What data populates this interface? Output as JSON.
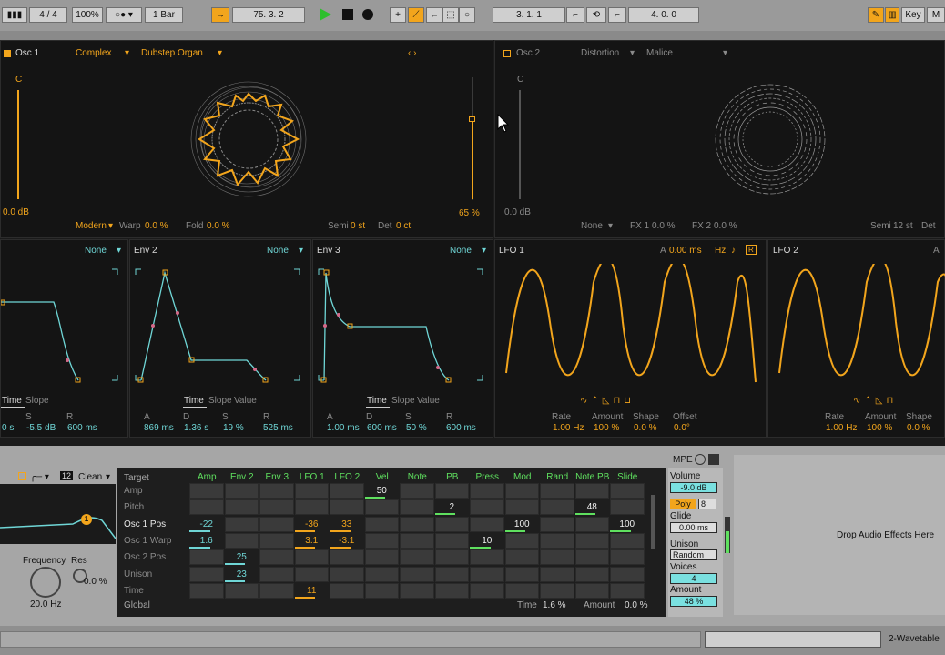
{
  "transport": {
    "signature": "4 / 4",
    "zoom": "100%",
    "quant": "1 Bar",
    "position": "75. 3. 2",
    "loop_start": "3. 1. 1",
    "loop_length": "4. 0. 0",
    "key_label": "Key",
    "m_label": "M"
  },
  "osc1": {
    "title": "Osc 1",
    "category": "Complex",
    "wavetable": "Dubstep Organ",
    "pitch_label": "C",
    "gain": "0.0 dB",
    "mode": "Modern",
    "warp_label": "Warp",
    "warp": "0.0 %",
    "fold_label": "Fold",
    "fold": "0.0 %",
    "semi_label": "Semi",
    "semi": "0 st",
    "det_label": "Det",
    "det": "0 ct",
    "level": "65 %"
  },
  "osc2": {
    "title": "Osc 2",
    "category": "Distortion",
    "wavetable": "Malice",
    "pitch_label": "C",
    "gain": "0.0 dB",
    "mode": "None",
    "fx1_label": "FX 1",
    "fx1": "0.0 %",
    "fx2_label": "FX 2",
    "fx2": "0.0 %",
    "semi_label": "Semi",
    "semi": "12 st",
    "det_label": "Det"
  },
  "env1": {
    "target": "None",
    "tabs": [
      "Time",
      "Slope"
    ],
    "labels": [
      "S",
      "R"
    ],
    "values": [
      "0 s",
      "-5.5 dB",
      "600 ms"
    ]
  },
  "env2": {
    "title": "Env 2",
    "target": "None",
    "tabs": [
      "Time",
      "Slope",
      "Value"
    ],
    "labels": [
      "A",
      "D",
      "S",
      "R"
    ],
    "values": [
      "869 ms",
      "1.36 s",
      "19 %",
      "525 ms"
    ]
  },
  "env3": {
    "title": "Env 3",
    "target": "None",
    "tabs": [
      "Time",
      "Slope",
      "Value"
    ],
    "labels": [
      "A",
      "D",
      "S",
      "R"
    ],
    "values": [
      "1.00 ms",
      "600 ms",
      "50 %",
      "600 ms"
    ]
  },
  "lfo1": {
    "title": "LFO 1",
    "attack_label": "A",
    "attack": "0.00 ms",
    "unit": "Hz",
    "labels": [
      "Rate",
      "Amount",
      "Shape",
      "Offset"
    ],
    "values": [
      "1.00 Hz",
      "100 %",
      "0.0 %",
      "0.0°"
    ]
  },
  "lfo2": {
    "title": "LFO 2",
    "labels": [
      "Rate",
      "Amount",
      "Shape"
    ],
    "values": [
      "1.00 Hz",
      "100 %",
      "0.0 %"
    ]
  },
  "filter": {
    "circuit": "Clean",
    "slope": "12",
    "freq_label": "Frequency",
    "res_label": "Res",
    "freq": "20.0 Hz",
    "res": "0.0 %",
    "badge": "1"
  },
  "matrix": {
    "title": "MPE",
    "target_label": "Target",
    "columns": [
      "Amp",
      "Env 2",
      "Env 3",
      "LFO 1",
      "LFO 2",
      "Vel",
      "Note",
      "PB",
      "Press",
      "Mod",
      "Rand",
      "Note PB",
      "Slide"
    ],
    "rows": [
      "Amp",
      "Pitch",
      "Osc 1 Pos",
      "Osc 1 Warp",
      "Osc 2 Pos",
      "Unison",
      "Time"
    ],
    "global_label": "Global",
    "time_label": "Time",
    "time": "1.6 %",
    "amount_label": "Amount",
    "amount": "0.0 %",
    "values": [
      {
        "text": "50",
        "row": 0,
        "col": 5
      },
      {
        "text": "2",
        "row": 1,
        "col": 7
      },
      {
        "text": "48",
        "row": 1,
        "col": 11
      },
      {
        "text": "-22",
        "row": 2,
        "col": 0
      },
      {
        "text": "-36",
        "row": 2,
        "col": 3
      },
      {
        "text": "33",
        "row": 2,
        "col": 4
      },
      {
        "text": "100",
        "row": 2,
        "col": 9
      },
      {
        "text": "100",
        "row": 2,
        "col": 12
      },
      {
        "text": "1.6",
        "row": 3,
        "col": 0
      },
      {
        "text": "3.1",
        "row": 3,
        "col": 3
      },
      {
        "text": "-3.1",
        "row": 3,
        "col": 4
      },
      {
        "text": "10",
        "row": 3,
        "col": 8
      },
      {
        "text": "25",
        "row": 4,
        "col": 1
      },
      {
        "text": "23",
        "row": 5,
        "col": 1
      },
      {
        "text": "11",
        "row": 6,
        "col": 3
      }
    ]
  },
  "global": {
    "volume_label": "Volume",
    "volume": "-9.0 dB",
    "poly": "Poly",
    "voices_count": "8",
    "glide_label": "Glide",
    "glide": "0.00 ms",
    "unison_label": "Unison",
    "unison": "Random",
    "voices_label": "Voices",
    "voices": "4",
    "amount_label": "Amount",
    "amount": "48 %"
  },
  "drop": {
    "text": "Drop Audio Effects Here"
  },
  "footer": {
    "track": "2-Wavetable"
  },
  "colors": {
    "accent": "#f2a51c",
    "cyan": "#6fd6d6",
    "green": "#5fe05f"
  }
}
